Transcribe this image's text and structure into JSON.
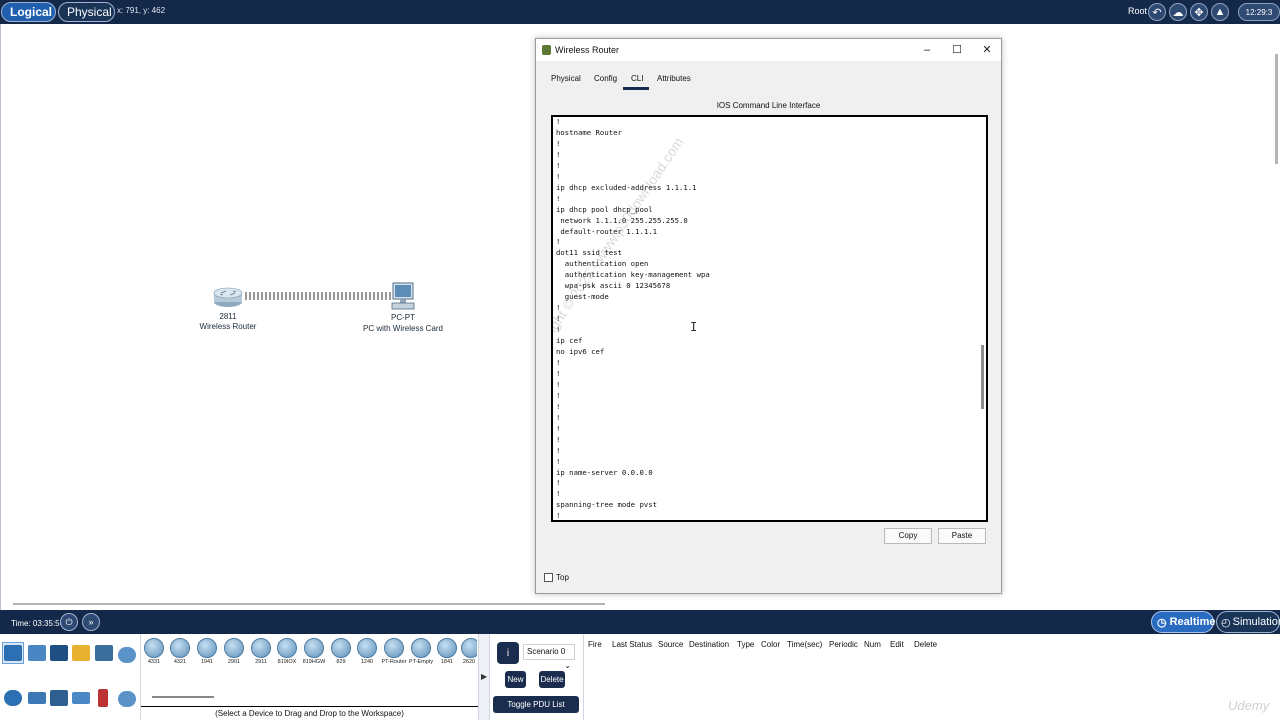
{
  "topbar": {
    "logical_tab": "Logical",
    "physical_tab": "Physical",
    "coords": "x: 791, y: 462",
    "user": "Root",
    "clock": "12:29:3"
  },
  "workspace": {
    "router": {
      "model": "2811",
      "name": "Wireless Router"
    },
    "pc": {
      "model": "PC-PT",
      "name": "PC with Wireless Card"
    }
  },
  "dialog": {
    "title": "Wireless Router",
    "tabs": [
      "Physical",
      "Config",
      "CLI",
      "Attributes"
    ],
    "active_tab": "CLI",
    "cli_heading": "IOS Command Line Interface",
    "cli_lines": [
      "!",
      "hostname Router",
      "!",
      "!",
      "!",
      "!",
      "ip dhcp excluded-address 1.1.1.1",
      "!",
      "ip dhcp pool dhcp_pool",
      " network 1.1.1.0 255.255.255.0",
      " default-router 1.1.1.1",
      "!",
      "dot11 ssid test",
      "  authentication open",
      "  authentication key-management wpa",
      "  wpa-psk ascii 0 12345678",
      "  guest-mode",
      "!",
      "!",
      "!",
      "ip cef",
      "no ipv6 cef",
      "!",
      "!",
      "!",
      "!",
      "!",
      "!",
      "!",
      "!",
      "!",
      "!",
      "ip name-server 0.0.0.0",
      "!",
      "!",
      "spanning-tree mode pvst",
      "!"
    ],
    "copy_label": "Copy",
    "paste_label": "Paste",
    "top_label": "Top",
    "watermark": "Copyright © 2025 - www.p30download.com"
  },
  "statusbar": {
    "time": "Time: 03:35:56",
    "realtime": "Realtime",
    "simulation": "Simulation"
  },
  "bottom": {
    "models": [
      "4331",
      "4321",
      "1941",
      "2901",
      "2911",
      "819IOX",
      "819HGW",
      "829",
      "1240",
      "PT-Router",
      "PT-Empty",
      "1841",
      "2620"
    ],
    "drag_hint": "(Select a Device to Drag and Drop to the Workspace)",
    "scenario": "Scenario 0",
    "new_label": "New",
    "delete_label": "Delete",
    "toggle_pdu": "Toggle PDU List Window",
    "pdu_headers": [
      "Fire",
      "Last Status",
      "Source",
      "Destination",
      "Type",
      "Color",
      "Time(sec)",
      "Periodic",
      "Num",
      "Edit",
      "Delete"
    ]
  },
  "brand": "Udemy",
  "colors": {
    "bar_bg": "#14294a",
    "realtime_accent": "#2a6bc2",
    "dialog_bg": "#f0f0f0"
  }
}
